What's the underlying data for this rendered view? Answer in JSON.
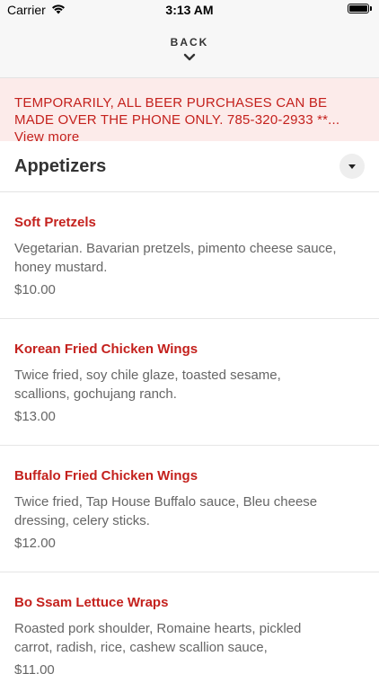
{
  "status_bar": {
    "carrier": "Carrier",
    "time": "3:13 AM"
  },
  "nav": {
    "back_label": "BACK"
  },
  "banner": {
    "text": "TEMPORARILY, ALL BEER PURCHASES CAN BE MADE OVER THE PHONE ONLY. 785-320-2933 **...",
    "view_more": "View more",
    "color": "#c4211d",
    "background": "#fcebea"
  },
  "section": {
    "title": "Appetizers",
    "toggle_icon": "caret-down-icon"
  },
  "items": [
    {
      "name": "Soft Pretzels",
      "description": "Vegetarian. Bavarian pretzels, pimento cheese sauce, honey mustard.",
      "price": "$10.00"
    },
    {
      "name": "Korean Fried Chicken Wings",
      "description": "Twice fried, soy chile glaze, toasted sesame, scallions, gochujang ranch.",
      "price": "$13.00"
    },
    {
      "name": "Buffalo Fried Chicken Wings",
      "description": "Twice fried, Tap House Buffalo sauce, Bleu cheese dressing, celery sticks.",
      "price": "$12.00"
    },
    {
      "name": "Bo Ssam Lettuce Wraps",
      "description": "Roasted pork shoulder, Romaine hearts, pickled carrot, radish, rice, cashew scallion sauce,",
      "price": "$11.00"
    }
  ],
  "colors": {
    "accent": "#c4211d",
    "text": "#333333",
    "muted": "#666666"
  }
}
